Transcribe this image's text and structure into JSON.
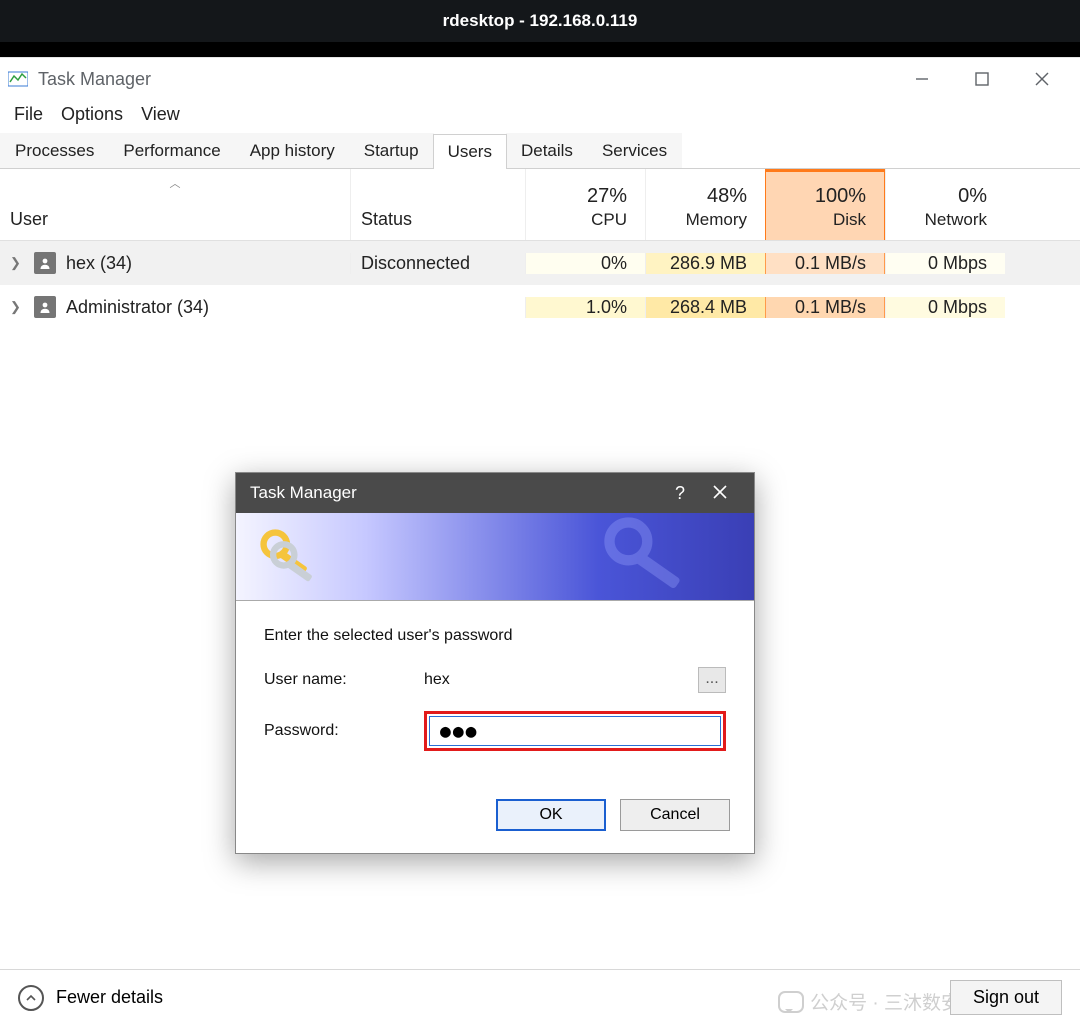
{
  "outer_title": "rdesktop - 192.168.0.119",
  "window_title": "Task Manager",
  "menu": {
    "file": "File",
    "options": "Options",
    "view": "View"
  },
  "tabs": [
    "Processes",
    "Performance",
    "App history",
    "Startup",
    "Users",
    "Details",
    "Services"
  ],
  "active_tab_index": 4,
  "columns": {
    "user": "User",
    "status": "Status",
    "cpu": {
      "pct": "27%",
      "label": "CPU"
    },
    "memory": {
      "pct": "48%",
      "label": "Memory"
    },
    "disk": {
      "pct": "100%",
      "label": "Disk"
    },
    "network": {
      "pct": "0%",
      "label": "Network"
    }
  },
  "rows": [
    {
      "name": "hex (34)",
      "status": "Disconnected",
      "cpu": "0%",
      "memory": "286.9 MB",
      "disk": "0.1 MB/s",
      "network": "0 Mbps"
    },
    {
      "name": "Administrator (34)",
      "status": "",
      "cpu": "1.0%",
      "memory": "268.4 MB",
      "disk": "0.1 MB/s",
      "network": "0 Mbps"
    }
  ],
  "footer": {
    "fewer": "Fewer details",
    "signout": "Sign out"
  },
  "watermark": "公众号 · 三沐数安",
  "dialog": {
    "title": "Task Manager",
    "prompt": "Enter the selected user's password",
    "username_label": "User name:",
    "username_value": "hex",
    "password_label": "Password:",
    "password_value": "●●●",
    "ok": "OK",
    "cancel": "Cancel",
    "help": "?",
    "ellipsis": "..."
  }
}
